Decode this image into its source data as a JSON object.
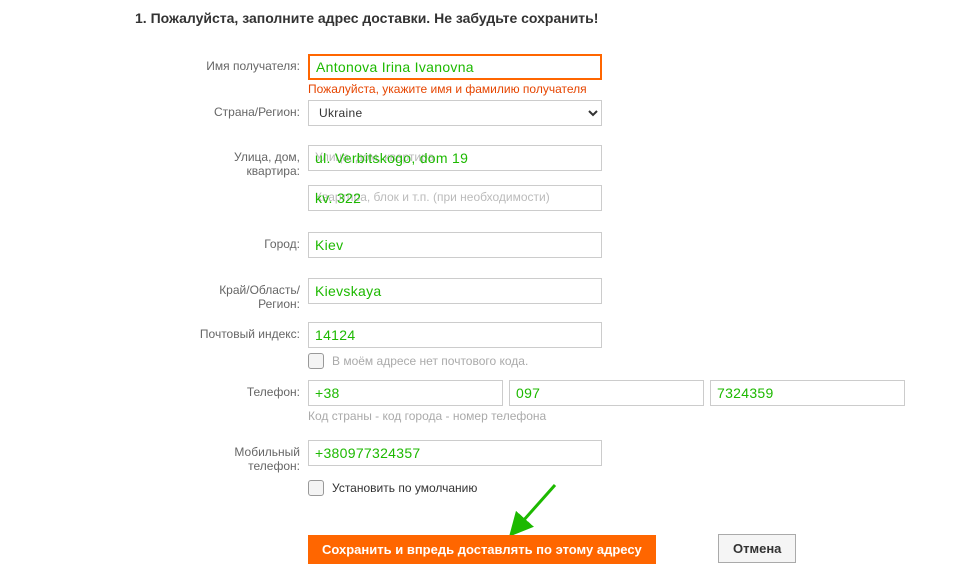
{
  "heading": "1. Пожалуйста, заполните адрес доставки. Не забудьте сохранить!",
  "labels": {
    "recipient": "Имя получателя:",
    "country": "Страна/Регион:",
    "street": "Улица, дом, квартира:",
    "city": "Город:",
    "region": "Край/Область/Регион:",
    "postcode": "Почтовый индекс:",
    "phone": "Телефон:",
    "mobile": "Мобильный телефон:"
  },
  "fields": {
    "recipient_value": "Antonova Irina Ivanovna",
    "recipient_validation": "Пожалуйста, укажите имя и фамилию получателя",
    "country_selected": "Ukraine",
    "street_value": "ul. Verbitskogo, dom 19",
    "street_placeholder": "Улица, дом, квартира",
    "street2_value": "kv. 322",
    "street2_placeholder": "Квартира, блок и т.п. (при необходимости)",
    "city_value": "Kiev",
    "region_value": "Kievskaya",
    "postcode_value": "14124",
    "no_postcode_label": "В моём адресе нет почтового кода.",
    "phone_cc": "+38",
    "phone_area": "097",
    "phone_number": "7324359",
    "phone_hint": "Код страны - код города - номер телефона",
    "mobile_value": "+380977324357",
    "set_default_label": "Установить по умолчанию"
  },
  "buttons": {
    "save": "Сохранить и впредь доставлять по этому адресу",
    "cancel": "Отмена"
  }
}
